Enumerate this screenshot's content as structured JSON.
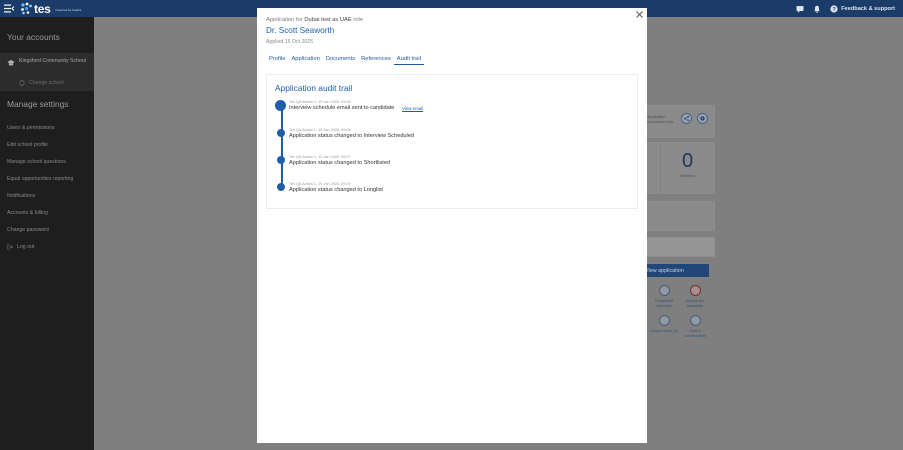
{
  "topbar": {
    "logo_text": "tes",
    "powered_by": "Powered by Solaris",
    "feedback_label": "Feedback & support"
  },
  "sidebar": {
    "accounts_heading": "Your accounts",
    "school_name": "Kingsford Community School",
    "change_school": "Change school",
    "settings_heading": "Manage settings",
    "items": [
      {
        "label": "Users & permissions"
      },
      {
        "label": "Edit school profile"
      },
      {
        "label": "Manage school questions"
      },
      {
        "label": "Equal opportunities reporting"
      },
      {
        "label": "Notifications"
      },
      {
        "label": "Accounts & billing"
      },
      {
        "label": "Change password"
      }
    ],
    "logout": "Log out"
  },
  "background": {
    "card_text_1": "Application",
    "card_text_2": "conversion flow",
    "declined_count": "0",
    "declined_label": "Declined",
    "view_application": "View application",
    "actions": [
      {
        "label": "Completed Interview"
      },
      {
        "label": "Decline the candidate"
      },
      {
        "label": "School notes (0)"
      },
      {
        "label": "Start a conversation"
      }
    ]
  },
  "modal": {
    "applied_prefix": "Application for",
    "role_name": "Dubai test as UAE",
    "role_suffix": "role",
    "candidate_name": "Dr. Scott Seaworth",
    "applied_date": "Applied 16 Oct 2025",
    "tabs": [
      {
        "label": "Profile",
        "active": false
      },
      {
        "label": "Application",
        "active": false
      },
      {
        "label": "Documents",
        "active": false
      },
      {
        "label": "References",
        "active": false
      },
      {
        "label": "Audit trail",
        "active": true
      }
    ],
    "audit": {
      "title": "Application audit trail",
      "view_email_label": "View email",
      "events": [
        {
          "meta": "Tes QA Admin 1, 19 Jan 2026, 09:06",
          "message": "Interview schedule email sent to candidate"
        },
        {
          "meta": "Tes QA Admin 1, 19 Jan 2026, 09:06",
          "message": "Application status changed to Interview Scheduled"
        },
        {
          "meta": "Tes QA Admin 1, 19 Jan 2026, 09:27",
          "message": "Application status changed to Shortlisted"
        },
        {
          "meta": "Tes QA Admin 1, 19 Jan 2026, 09:25",
          "message": "Application status changed to Longlist"
        }
      ]
    }
  },
  "colors": {
    "brand_navy": "#1b3c68",
    "link_blue": "#1d5fa8",
    "sidebar_bg": "#1e1e1e",
    "overlay_bg": "#7f7f7f"
  },
  "icons": [
    "menu-icon",
    "tes-logo-icon",
    "chat-icon",
    "bell-icon",
    "help-icon",
    "school-icon",
    "change-icon",
    "logout-icon",
    "close-icon",
    "share-icon",
    "settings-icon"
  ]
}
